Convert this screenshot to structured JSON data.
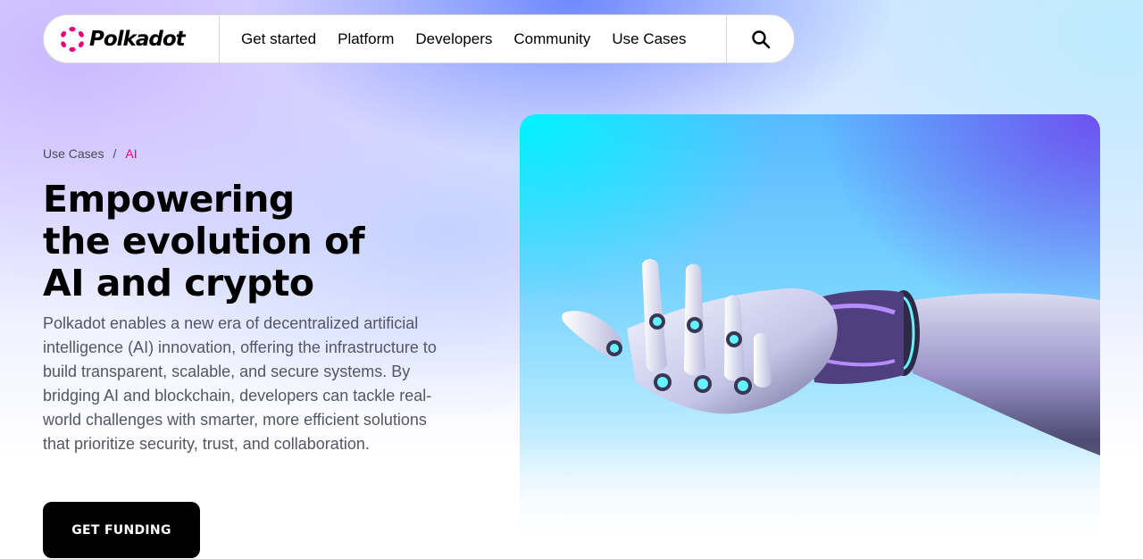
{
  "brand": {
    "name": "Polkadot",
    "accent": "#e6007a"
  },
  "nav": {
    "items": [
      {
        "label": "Get started"
      },
      {
        "label": "Platform"
      },
      {
        "label": "Developers"
      },
      {
        "label": "Community"
      },
      {
        "label": "Use Cases"
      }
    ],
    "search_icon": "search-icon"
  },
  "breadcrumb": {
    "parent": "Use Cases",
    "separator": "/",
    "current": "AI"
  },
  "hero": {
    "title_line1": "Empowering",
    "title_line2": "the evolution of",
    "title_line3": "AI and crypto",
    "description": "Polkadot enables a new era of decentralized artificial intelligence (AI) innovation, offering the infrastructure to build transparent, scalable, and secure systems. By bridging AI and blockchain, developers can tackle real-world challenges with smarter, more efficient solutions that prioritize security, trust, and collaboration.",
    "cta_label": "GET FUNDING",
    "image_subject": "robotic-hand-illustration"
  }
}
